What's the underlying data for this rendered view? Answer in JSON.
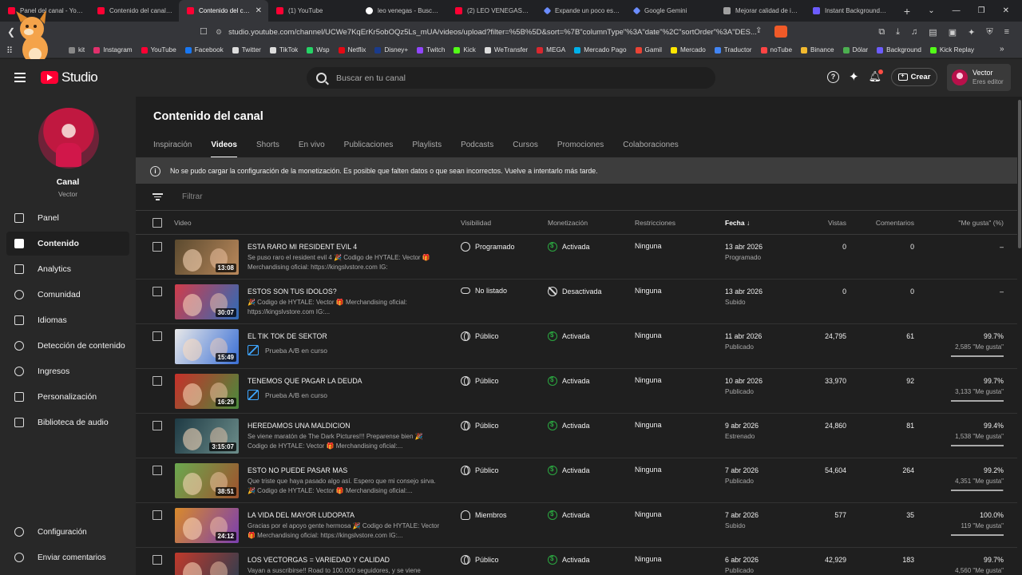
{
  "browser": {
    "tabs": [
      {
        "title": "Panel del canal - YouTube",
        "icon": "youtube-icon",
        "active": false
      },
      {
        "title": "Contenido del canal - YouTube Studio",
        "icon": "youtube-icon",
        "active": false
      },
      {
        "title": "Contenido del canal - YouTube Studio",
        "icon": "youtube-icon",
        "active": true
      },
      {
        "title": "(1) YouTube",
        "icon": "youtube-icon",
        "active": false
      },
      {
        "title": "leo venegas - Buscar con Google",
        "icon": "google-icon",
        "active": false
      },
      {
        "title": "(2) LEO VENEGAS - YouTube",
        "icon": "youtube-icon",
        "active": false
      },
      {
        "title": "Expande un poco esta descripción",
        "icon": "gemini-icon",
        "active": false
      },
      {
        "title": "Google Gemini",
        "icon": "gemini-icon",
        "active": false
      },
      {
        "title": "Mejorar calidad de imagen",
        "icon": "ai-icon",
        "active": false
      },
      {
        "title": "Instant Background Remover",
        "icon": "p-icon",
        "active": false
      }
    ],
    "url": "studio.youtube.com/channel/UCWe7KqErKr5obOQz5Ls_mUA/videos/upload?filter=%5B%5D&sort=%7B\"columnType\"%3A\"date\"%2C\"sortOrder\"%3A\"DES...",
    "bookmarks": [
      {
        "label": "kit",
        "color": "#888888"
      },
      {
        "label": "Instagram",
        "color": "#e1306c"
      },
      {
        "label": "YouTube",
        "color": "#ff0033"
      },
      {
        "label": "Facebook",
        "color": "#1877f2"
      },
      {
        "label": "Twitter",
        "color": "#dddddd"
      },
      {
        "label": "TikTok",
        "color": "#dddddd"
      },
      {
        "label": "Wsp",
        "color": "#25d366"
      },
      {
        "label": "Netflix",
        "color": "#e50914"
      },
      {
        "label": "Disney+",
        "color": "#1a3b8c"
      },
      {
        "label": "Twitch",
        "color": "#9146ff"
      },
      {
        "label": "Kick",
        "color": "#53fc18"
      },
      {
        "label": "WeTransfer",
        "color": "#dddddd"
      },
      {
        "label": "MEGA",
        "color": "#d9272e"
      },
      {
        "label": "Mercado Pago",
        "color": "#00b1ea"
      },
      {
        "label": "Gamil",
        "color": "#ea4335"
      },
      {
        "label": "Mercado",
        "color": "#ffe600"
      },
      {
        "label": "Traductor",
        "color": "#4285f4"
      },
      {
        "label": "noTube",
        "color": "#ff4444"
      },
      {
        "label": "Binance",
        "color": "#f3ba2f"
      },
      {
        "label": "Dólar",
        "color": "#4caf50"
      },
      {
        "label": "Background",
        "color": "#6c5cff"
      },
      {
        "label": "Kick Replay",
        "color": "#53fc18"
      }
    ]
  },
  "header": {
    "logo_text": "Studio",
    "search_placeholder": "Buscar en tu canal",
    "help_glyph": "?",
    "create_label": "Crear",
    "user_name": "Vector",
    "user_role": "Eres editor"
  },
  "sidebar": {
    "channel_label": "Canal",
    "channel_name": "Vector",
    "items": [
      {
        "label": "Panel",
        "icon": "dashboard-icon"
      },
      {
        "label": "Contenido",
        "icon": "content-icon",
        "active": true
      },
      {
        "label": "Analytics",
        "icon": "analytics-icon"
      },
      {
        "label": "Comunidad",
        "icon": "community-icon"
      },
      {
        "label": "Idiomas",
        "icon": "subtitles-icon"
      },
      {
        "label": "Detección de contenido",
        "icon": "copyright-icon"
      },
      {
        "label": "Ingresos",
        "icon": "earn-icon"
      },
      {
        "label": "Personalización",
        "icon": "customization-icon"
      },
      {
        "label": "Biblioteca de audio",
        "icon": "audio-library-icon"
      }
    ],
    "bottom": [
      {
        "label": "Configuración",
        "icon": "gear-icon"
      },
      {
        "label": "Enviar comentarios",
        "icon": "feedback-icon"
      }
    ]
  },
  "main": {
    "title": "Contenido del canal",
    "tabs": [
      "Inspiración",
      "Videos",
      "Shorts",
      "En vivo",
      "Publicaciones",
      "Playlists",
      "Podcasts",
      "Cursos",
      "Promociones",
      "Colaboraciones"
    ],
    "active_tab": "Videos",
    "notice": "No se pudo cargar la configuración de la monetización. Es posible que falten datos o que sean incorrectos. Vuelve a intentarlo más tarde.",
    "notice_glyph": "i",
    "filter_placeholder": "Filtrar",
    "columns": {
      "video": "Video",
      "visibility": "Visibilidad",
      "monetization": "Monetización",
      "restrictions": "Restricciones",
      "date": "Fecha",
      "views": "Vistas",
      "comments": "Comentarios",
      "likes": "\"Me gusta\" (%)"
    },
    "rows": [
      {
        "title": "ESTA RARO MI RESIDENT EVIL 4",
        "desc": "Se puso raro el resident evil 4 🎉 Codigo de HYTALE: Vector 🎁 Merchandising oficial: https://kingslvstore.com IG:",
        "ab": "",
        "duration": "13:08",
        "visibility": "Programado",
        "vis_icon": "clock-icon",
        "monetization": "Activada",
        "mon_icon": "monetization-on-icon",
        "restrictions": "Ninguna",
        "date": "13 abr 2026",
        "date_sub": "Programado",
        "views": "0",
        "comments": "0",
        "likes": "–",
        "likes_sub": "",
        "likes_fraction": null,
        "thumb": [
          "#5b4a2f",
          "#b9885b"
        ]
      },
      {
        "title": "ESTOS SON TUS IDOLOS?",
        "desc": "🎉 Codigo de HYTALE: Vector 🎁 Merchandising oficial: https://kingslvstore.com IG:...",
        "ab": "",
        "duration": "30:07",
        "visibility": "No listado",
        "vis_icon": "link-icon",
        "monetization": "Desactivada",
        "mon_icon": "monetization-off-icon",
        "restrictions": "Ninguna",
        "date": "13 abr 2026",
        "date_sub": "Subido",
        "views": "0",
        "comments": "0",
        "likes": "–",
        "likes_sub": "",
        "likes_fraction": null,
        "thumb": [
          "#d13c4a",
          "#2d6bb8"
        ]
      },
      {
        "title": "EL TIK TOK DE SEKTOR",
        "desc": "",
        "ab": "Prueba A/B en curso",
        "duration": "15:49",
        "visibility": "Público",
        "vis_icon": "globe-icon",
        "monetization": "Activada",
        "mon_icon": "monetization-on-icon",
        "restrictions": "Ninguna",
        "date": "11 abr 2026",
        "date_sub": "Publicado",
        "views": "24,795",
        "comments": "61",
        "likes": "99.7%",
        "likes_sub": "2,585 \"Me gusta\"",
        "likes_fraction": 0.997,
        "thumb": [
          "#e8e8e8",
          "#3a6fd6"
        ]
      },
      {
        "title": "TENEMOS QUE PAGAR LA DEUDA",
        "desc": "",
        "ab": "Prueba A/B en curso",
        "duration": "16:29",
        "visibility": "Público",
        "vis_icon": "globe-icon",
        "monetization": "Activada",
        "mon_icon": "monetization-on-icon",
        "restrictions": "Ninguna",
        "date": "10 abr 2026",
        "date_sub": "Publicado",
        "views": "33,970",
        "comments": "92",
        "likes": "99.7%",
        "likes_sub": "3,133 \"Me gusta\"",
        "likes_fraction": 0.997,
        "thumb": [
          "#c7302a",
          "#4a8a3c"
        ]
      },
      {
        "title": "HEREDAMOS UNA MALDICION",
        "desc": "Se viene maratón de The Dark Pictures!!! Preparense bien 🎉 Codigo de HYTALE: Vector 🎁 Merchandising oficial:...",
        "ab": "",
        "duration": "3:15:07",
        "visibility": "Público",
        "vis_icon": "globe-icon",
        "monetization": "Activada",
        "mon_icon": "monetization-on-icon",
        "restrictions": "Ninguna",
        "date": "9 abr 2026",
        "date_sub": "Estrenado",
        "views": "24,860",
        "comments": "81",
        "likes": "99.4%",
        "likes_sub": "1,538 \"Me gusta\"",
        "likes_fraction": 0.994,
        "thumb": [
          "#1e3a44",
          "#6c8d8a"
        ]
      },
      {
        "title": "ESTO NO PUEDE PASAR MAS",
        "desc": "Que triste que haya pasado algo así. Espero que mi consejo sirva. 🎉 Codigo de HYTALE: Vector 🎁 Merchandising oficial:...",
        "ab": "",
        "duration": "38:51",
        "visibility": "Público",
        "vis_icon": "globe-icon",
        "monetization": "Activada",
        "mon_icon": "monetization-on-icon",
        "restrictions": "Ninguna",
        "date": "7 abr 2026",
        "date_sub": "Publicado",
        "views": "54,604",
        "comments": "264",
        "likes": "99.2%",
        "likes_sub": "4,351 \"Me gusta\"",
        "likes_fraction": 0.992,
        "thumb": [
          "#6aa84f",
          "#a0522d"
        ]
      },
      {
        "title": "LA VIDA DEL MAYOR LUDOPATA",
        "desc": "Gracias por el apoyo gente hermosa 🎉 Codigo de HYTALE: Vector 🎁 Merchandising oficial: https://kingslvstore.com IG:...",
        "ab": "",
        "duration": "24:12",
        "visibility": "Miembros",
        "vis_icon": "members-icon",
        "monetization": "Activada",
        "mon_icon": "monetization-on-icon",
        "restrictions": "Ninguna",
        "date": "7 abr 2026",
        "date_sub": "Subido",
        "views": "577",
        "comments": "35",
        "likes": "100.0%",
        "likes_sub": "119 \"Me gusta\"",
        "likes_fraction": 1.0,
        "thumb": [
          "#d98a2b",
          "#7a3fb0"
        ]
      },
      {
        "title": "LOS VECTORGAS = VARIEDAD Y CALIDAD",
        "desc": "Vayan a suscribirse!! Road to 100.000 seguidores, y se viene",
        "ab": "",
        "duration": "",
        "visibility": "Público",
        "vis_icon": "globe-icon",
        "monetization": "Activada",
        "mon_icon": "monetization-on-icon",
        "restrictions": "Ninguna",
        "date": "6 abr 2026",
        "date_sub": "Publicado",
        "views": "42,929",
        "comments": "183",
        "likes": "99.7%",
        "likes_sub": "4,560 \"Me gusta\"",
        "likes_fraction": 0.997,
        "thumb": [
          "#c0392b",
          "#2c3e50"
        ]
      }
    ]
  },
  "colors": {
    "accent_red": "#ff0033",
    "monetization_green": "#2ba640",
    "link_blue": "#3ea6ff"
  }
}
